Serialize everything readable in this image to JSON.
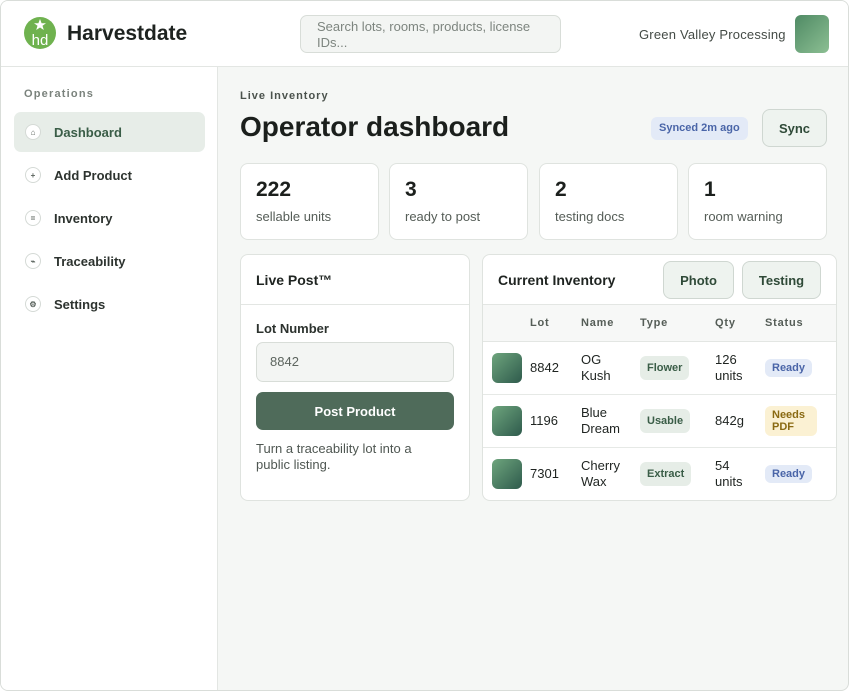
{
  "app": {
    "brand": "Harvestdate",
    "logo_text": "hd"
  },
  "search": {
    "placeholder": "Search lots, rooms, products, license IDs..."
  },
  "org": {
    "name": "Green Valley Processing"
  },
  "sidebar": {
    "heading": "Operations",
    "items": [
      {
        "label": "Dashboard",
        "icon": "home-icon",
        "glyph": "⌂",
        "active": true
      },
      {
        "label": "Add Product",
        "icon": "plus-icon",
        "glyph": "+",
        "active": false
      },
      {
        "label": "Inventory",
        "icon": "list-icon",
        "glyph": "=",
        "active": false
      },
      {
        "label": "Traceability",
        "icon": "trace-icon",
        "glyph": "⌁",
        "active": false
      },
      {
        "label": "Settings",
        "icon": "gear-icon",
        "glyph": "⚙",
        "active": false
      }
    ]
  },
  "header": {
    "eyebrow": "Live Inventory",
    "title": "Operator dashboard",
    "synced": "Synced 2m ago",
    "sync_label": "Sync"
  },
  "stats": [
    {
      "value": "222",
      "label": "sellable units"
    },
    {
      "value": "3",
      "label": "ready to post"
    },
    {
      "value": "2",
      "label": "testing docs"
    },
    {
      "value": "1",
      "label": "room warning"
    }
  ],
  "live_post": {
    "title": "Live Post™",
    "field_label": "Lot Number",
    "field_value": "8842",
    "button": "Post Product",
    "help": "Turn a traceability lot into a public listing."
  },
  "inventory": {
    "title": "Current Inventory",
    "photo_label": "Photo",
    "testing_label": "Testing",
    "columns": [
      "",
      "Lot",
      "Name",
      "Type",
      "Qty",
      "Status"
    ],
    "rows": [
      {
        "lot": "8842",
        "name": "OG Kush",
        "type": "Flower",
        "qty": "126 units",
        "status": "Ready",
        "status_kind": "ready"
      },
      {
        "lot": "1196",
        "name": "Blue Dream",
        "type": "Usable",
        "qty": "842g",
        "status": "Needs PDF",
        "status_kind": "warn"
      },
      {
        "lot": "7301",
        "name": "Cherry Wax",
        "type": "Extract",
        "qty": "54 units",
        "status": "Ready",
        "status_kind": "ready"
      }
    ]
  },
  "colors": {
    "accent": "#4f6b5a",
    "ready_bg": "#e3eaf7",
    "ready_fg": "#4a65a8",
    "warn_bg": "#fbf1d3",
    "warn_fg": "#8a6a12"
  }
}
